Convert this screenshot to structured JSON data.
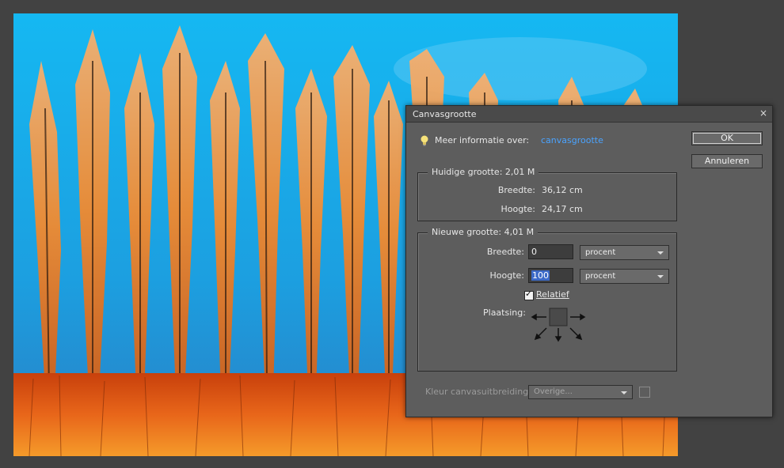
{
  "dialog": {
    "title": "Canvasgrootte",
    "close": "×",
    "info_label": "Meer informatie over:",
    "info_link": "canvasgrootte",
    "ok": "OK",
    "cancel": "Annuleren",
    "current": {
      "legend": "Huidige grootte:  2,01 M",
      "width_label": "Breedte:",
      "width_value": "36,12 cm",
      "height_label": "Hoogte:",
      "height_value": "24,17 cm"
    },
    "new": {
      "legend": "Nieuwe grootte:  4,01 M",
      "width_label": "Breedte:",
      "width_value": "0",
      "width_unit": "procent",
      "height_label": "Hoogte:",
      "height_value": "100",
      "height_unit": "procent",
      "relative_label": "Relatief",
      "relative_checked": true,
      "anchor_label": "Plaatsing:"
    },
    "extension": {
      "label": "Kleur canvasuitbreiding:",
      "value": "Overige..."
    }
  },
  "colors": {
    "sky": "#1aa7ea",
    "tree": "#f07a1a",
    "link": "#4aa3ff",
    "dialog_bg": "#5d5d5d"
  }
}
